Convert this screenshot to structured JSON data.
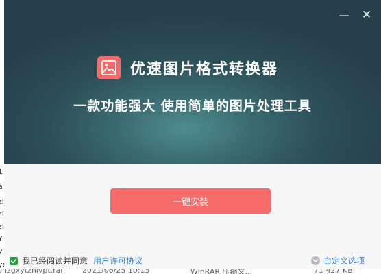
{
  "window": {
    "minimize_glyph": "—",
    "close_glyph": "✕"
  },
  "header": {
    "logo_icon": "image-icon",
    "app_title": "优速图片格式转换器",
    "slogan": "一款功能强大 使用简单的图片处理工具"
  },
  "main": {
    "install_button": "一键安装"
  },
  "footer": {
    "agree_checked": true,
    "agree_text": "我已经阅读并同意",
    "license_link": "用户许可协议",
    "custom_label": "自定义选项"
  },
  "background_window": {
    "left_fragments": [
      "1",
      "a",
      "zl",
      "zl",
      "zl",
      "Y",
      "y",
      "ya"
    ],
    "bottom_fragments": [
      "pnzgxytznlvpt.rar",
      "2021/06/25 10:15",
      "WinRAR 压缩文...",
      "71 427 KB"
    ]
  },
  "colors": {
    "header_dark": "#263f4a",
    "header_glow": "#4f8c8e",
    "accent_red": "#f56c6a",
    "link_blue": "#2d7bd6",
    "check_green": "#2a9d3c"
  }
}
